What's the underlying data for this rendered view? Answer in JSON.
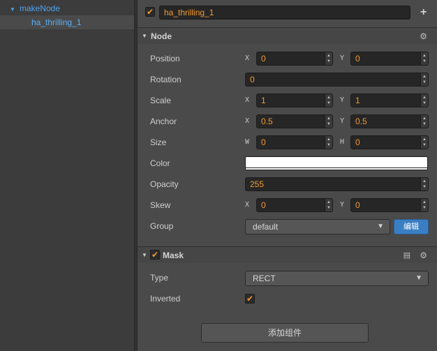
{
  "hierarchy": {
    "root": "makeNode",
    "child": "ha_thrilling_1"
  },
  "node": {
    "name": "ha_thrilling_1",
    "active_checked": true
  },
  "node_section": {
    "title": "Node",
    "props": {
      "position": {
        "label": "Position",
        "x_axis": "X",
        "y_axis": "Y",
        "x": "0",
        "y": "0"
      },
      "rotation": {
        "label": "Rotation",
        "value": "0"
      },
      "scale": {
        "label": "Scale",
        "x_axis": "X",
        "y_axis": "Y",
        "x": "1",
        "y": "1"
      },
      "anchor": {
        "label": "Anchor",
        "x_axis": "X",
        "y_axis": "Y",
        "x": "0.5",
        "y": "0.5"
      },
      "size": {
        "label": "Size",
        "x_axis": "W",
        "y_axis": "H",
        "x": "0",
        "y": "0"
      },
      "color": {
        "label": "Color",
        "value": "#ffffff"
      },
      "opacity": {
        "label": "Opacity",
        "value": "255"
      },
      "skew": {
        "label": "Skew",
        "x_axis": "X",
        "y_axis": "Y",
        "x": "0",
        "y": "0"
      },
      "group": {
        "label": "Group",
        "value": "default",
        "edit_label": "编辑"
      }
    }
  },
  "mask_section": {
    "title": "Mask",
    "enabled": true,
    "type": {
      "label": "Type",
      "value": "RECT"
    },
    "inverted": {
      "label": "Inverted",
      "checked": true
    }
  },
  "add_component_label": "添加组件",
  "colors": {
    "accent": "#f19a31",
    "link": "#4fa3ee",
    "button_blue": "#3a7fc4"
  }
}
